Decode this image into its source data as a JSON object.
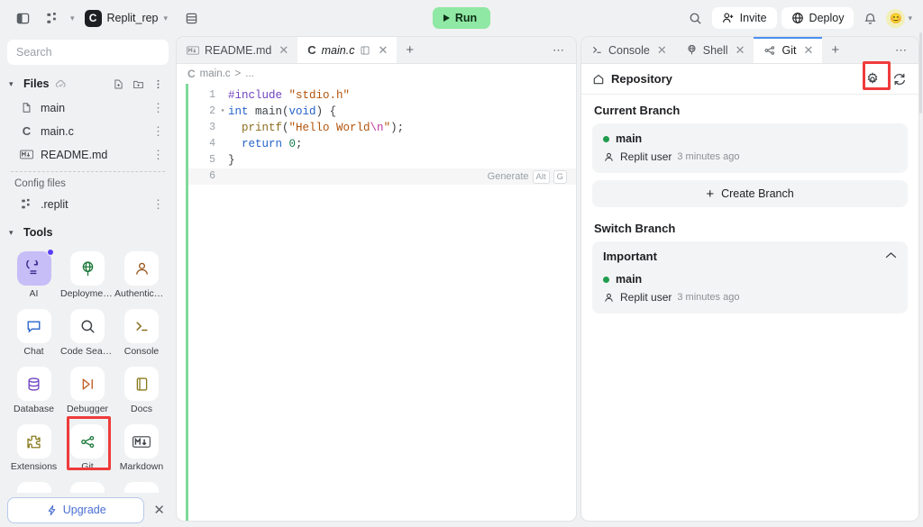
{
  "topbar": {
    "sidebar_toggle_icon": "panel-left-icon",
    "tree_icon": "tree-icon",
    "repl_logo_letter": "C",
    "repl_name": "Replit_rep",
    "layout_icon": "layout-icon",
    "run_label": "Run",
    "search_icon": "search-icon",
    "invite_label": "Invite",
    "deploy_label": "Deploy",
    "bell_icon": "bell-icon",
    "avatar_emoji": "😊"
  },
  "sidebar": {
    "search_placeholder": "Search",
    "files_section": {
      "title": "Files",
      "sync_icon": "cloud-check-icon",
      "new_file_icon": "new-file-icon",
      "new_folder_icon": "new-folder-icon",
      "menu_icon": "kebab-icon",
      "items": [
        {
          "name": "main",
          "icon": "file-icon"
        },
        {
          "name": "main.c",
          "icon": "c-file-icon"
        },
        {
          "name": "README.md",
          "icon": "markdown-file-icon"
        }
      ]
    },
    "config_label": "Config files",
    "config_items": [
      {
        "name": ".replit",
        "icon": "replit-file-icon"
      }
    ],
    "tools_section": {
      "title": "Tools",
      "items": [
        {
          "label": "AI",
          "icon": "ai-icon",
          "active": true,
          "badge": true
        },
        {
          "label": "Deployments",
          "icon": "deployments-icon"
        },
        {
          "label": "Authenticati...",
          "icon": "authentication-icon"
        },
        {
          "label": "Chat",
          "icon": "chat-icon"
        },
        {
          "label": "Code Search",
          "icon": "code-search-icon"
        },
        {
          "label": "Console",
          "icon": "console-icon"
        },
        {
          "label": "Database",
          "icon": "database-icon"
        },
        {
          "label": "Debugger",
          "icon": "debugger-icon"
        },
        {
          "label": "Docs",
          "icon": "docs-icon"
        },
        {
          "label": "Extensions",
          "icon": "extensions-icon"
        },
        {
          "label": "Git",
          "icon": "git-icon",
          "highlighted": true
        },
        {
          "label": "Markdown",
          "icon": "markdown-icon"
        }
      ]
    },
    "upgrade_label": "Upgrade",
    "upgrade_icon": "lightning-icon",
    "upgrade_close_icon": "close-icon"
  },
  "editor": {
    "tabs": [
      {
        "label": "README.md",
        "icon": "markdown-file-icon",
        "active": false
      },
      {
        "label": "main.c",
        "icon": "c-file-icon",
        "active": true,
        "extra_icon": "preview-icon"
      }
    ],
    "add_tab_icon": "plus-icon",
    "more_icon": "ellipsis-icon",
    "breadcrumb": {
      "file_icon": "c-file-icon",
      "file": "main.c",
      "separator": ">",
      "rest": "..."
    },
    "lines": [
      {
        "no": "1",
        "fold": "",
        "tokens": [
          {
            "t": "#include ",
            "c": "s-pre"
          },
          {
            "t": "\"stdio.h\"",
            "c": "s-str"
          }
        ]
      },
      {
        "no": "2",
        "fold": "v",
        "tokens": [
          {
            "t": "int ",
            "c": "s-kw"
          },
          {
            "t": "main",
            "c": "s-pun"
          },
          {
            "t": "(",
            "c": "s-pun"
          },
          {
            "t": "void",
            "c": "s-kw"
          },
          {
            "t": ") {",
            "c": "s-pun"
          }
        ]
      },
      {
        "no": "3",
        "fold": "",
        "tokens": [
          {
            "t": "  printf",
            "c": "s-fn"
          },
          {
            "t": "(",
            "c": "s-pun"
          },
          {
            "t": "\"Hello World",
            "c": "s-str"
          },
          {
            "t": "\\n",
            "c": "s-esc"
          },
          {
            "t": "\"",
            "c": "s-str"
          },
          {
            "t": ");",
            "c": "s-pun"
          }
        ]
      },
      {
        "no": "4",
        "fold": "",
        "tokens": [
          {
            "t": "  return ",
            "c": "s-kw"
          },
          {
            "t": "0",
            "c": "s-num"
          },
          {
            "t": ";",
            "c": "s-pun"
          }
        ]
      },
      {
        "no": "5",
        "fold": "",
        "tokens": [
          {
            "t": "}",
            "c": "s-pun"
          }
        ]
      },
      {
        "no": "6",
        "fold": "",
        "current": true,
        "tokens": []
      }
    ],
    "generate_hint": {
      "label": "Generate",
      "key1": "Alt",
      "key2": "G"
    }
  },
  "right_panel": {
    "tabs": [
      {
        "label": "Console",
        "icon": "console-icon",
        "active": false
      },
      {
        "label": "Shell",
        "icon": "shell-icon",
        "active": false
      },
      {
        "label": "Git",
        "icon": "git-icon",
        "active": true
      }
    ],
    "add_tab_icon": "plus-icon",
    "more_icon": "ellipsis-icon",
    "repository": {
      "home_icon": "home-icon",
      "title": "Repository",
      "settings_icon": "gear-icon",
      "refresh_icon": "refresh-icon"
    },
    "current_branch": {
      "heading": "Current Branch",
      "branch": "main",
      "user_icon": "user-icon",
      "user": "Replit user",
      "time": "3 minutes ago"
    },
    "create_branch": {
      "plus_icon": "plus-icon",
      "label": "Create Branch"
    },
    "switch_branch": {
      "heading": "Switch Branch",
      "group_name": "Important",
      "collapse_icon": "chevron-up-icon",
      "branch": "main",
      "user_icon": "user-icon",
      "user": "Replit user",
      "time": "3 minutes ago"
    }
  },
  "colors": {
    "run_green": "#8fe8a3",
    "branch_green": "#1f9c4d",
    "annotation_red": "#ef3b3b",
    "ai_purple": "#c7bdf7",
    "tab_accent": "#4a8ef0"
  }
}
